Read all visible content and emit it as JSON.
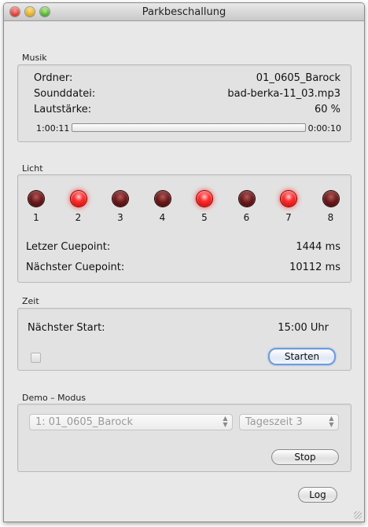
{
  "window": {
    "title": "Parkbeschallung"
  },
  "musik": {
    "label": "Musik",
    "ordner_label": "Ordner:",
    "ordner_value": "01_0605_Barock",
    "sounddatei_label": "Sounddatei:",
    "sounddatei_value": "bad-berka-11_03.mp3",
    "lautstaerke_label": "Lautstärke:",
    "lautstaerke_value": "60 %",
    "time_elapsed": "1:00:11",
    "time_remaining": "0:00:10",
    "progress_fraction": 0
  },
  "licht": {
    "label": "Licht",
    "lights": [
      {
        "num": "1",
        "on": false
      },
      {
        "num": "2",
        "on": true
      },
      {
        "num": "3",
        "on": false
      },
      {
        "num": "4",
        "on": false
      },
      {
        "num": "5",
        "on": true
      },
      {
        "num": "6",
        "on": false
      },
      {
        "num": "7",
        "on": true
      },
      {
        "num": "8",
        "on": false
      }
    ],
    "letzter_label": "Letzer Cuepoint:",
    "letzter_value": "1444 ms",
    "naechster_label": "Nächster Cuepoint:",
    "naechster_value": "10112 ms"
  },
  "zeit": {
    "label": "Zeit",
    "naechster_start_label": "Nächster Start:",
    "naechster_start_value": "15:00 Uhr",
    "start_button": "Starten"
  },
  "demo": {
    "label": "Demo – Modus",
    "ordner_select": "1: 01_0605_Barock",
    "tageszeit_select": "Tageszeit 3",
    "stop_button": "Stop"
  },
  "log_button": "Log"
}
